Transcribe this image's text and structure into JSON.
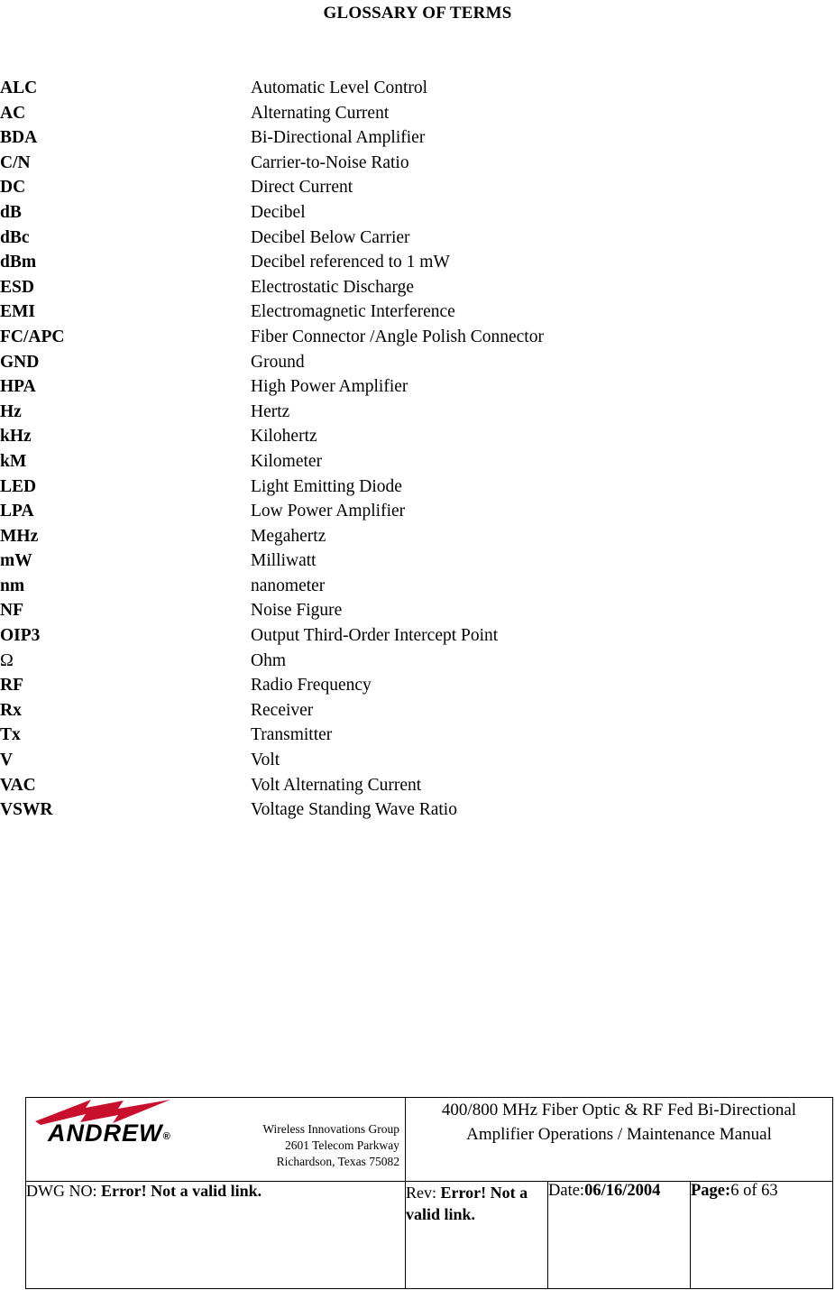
{
  "page": {
    "title": "GLOSSARY OF TERMS"
  },
  "glossary": {
    "entries": [
      {
        "term": "ALC",
        "definition": "Automatic Level Control"
      },
      {
        "term": "AC",
        "definition": "Alternating Current"
      },
      {
        "term": "BDA",
        "definition": "Bi-Directional Amplifier"
      },
      {
        "term": "C/N",
        "definition": "Carrier-to-Noise Ratio"
      },
      {
        "term": "DC",
        "definition": "Direct Current"
      },
      {
        "term": "dB",
        "definition": "Decibel"
      },
      {
        "term": "dBc",
        "definition": "Decibel Below Carrier"
      },
      {
        "term": "dBm",
        "definition": "Decibel referenced to 1 mW"
      },
      {
        "term": "ESD",
        "definition": "Electrostatic Discharge"
      },
      {
        "term": "EMI",
        "definition": "Electromagnetic Interference"
      },
      {
        "term": "FC/APC",
        "definition": "Fiber Connector /Angle Polish Connector"
      },
      {
        "term": "GND",
        "definition": "Ground"
      },
      {
        "term": "HPA",
        "definition": "High Power Amplifier"
      },
      {
        "term": "Hz",
        "definition": "Hertz"
      },
      {
        "term": "kHz",
        "definition": "Kilohertz"
      },
      {
        "term": "kM",
        "definition": "Kilometer"
      },
      {
        "term": "LED",
        "definition": "Light Emitting Diode"
      },
      {
        "term": "LPA",
        "definition": "Low Power Amplifier"
      },
      {
        "term": "MHz",
        "definition": "Megahertz"
      },
      {
        "term": "mW",
        "definition": "Milliwatt"
      },
      {
        "term": "nm",
        "definition": "nanometer"
      },
      {
        "term": "NF",
        "definition": "Noise Figure"
      },
      {
        "term": "OIP3",
        "definition": "Output Third-Order Intercept Point"
      },
      {
        "term": "Ω",
        "definition": "Ohm",
        "symbol": true
      },
      {
        "term": "RF",
        "definition": "Radio Frequency"
      },
      {
        "term": "Rx",
        "definition": "Receiver"
      },
      {
        "term": "Tx",
        "definition": "Transmitter"
      },
      {
        "term": "V",
        "definition": "Volt"
      },
      {
        "term": "VAC",
        "definition": "Volt Alternating Current"
      },
      {
        "term": "VSWR",
        "definition": "Voltage Standing Wave Ratio"
      }
    ]
  },
  "footer": {
    "logo": {
      "wordmark": "ANDREW",
      "registered_mark": "®",
      "bolt_color": "#C8102E"
    },
    "address": {
      "line1": "Wireless Innovations Group",
      "line2": "2601 Telecom Parkway",
      "line3": "Richardson, Texas 75082"
    },
    "manual_title": {
      "line1": "400/800 MHz Fiber Optic & RF Fed Bi-Directional",
      "line2": "Amplifier Operations / Maintenance Manual"
    },
    "dwg": {
      "label": "DWG NO: ",
      "value": "Error! Not a valid link."
    },
    "rev": {
      "label": "Rev:",
      "value": "Error! Not a valid link."
    },
    "date": {
      "label": "Date:",
      "value": "06/16/2004"
    },
    "page_number": {
      "label": "Page:",
      "value": "6 of 63"
    }
  }
}
